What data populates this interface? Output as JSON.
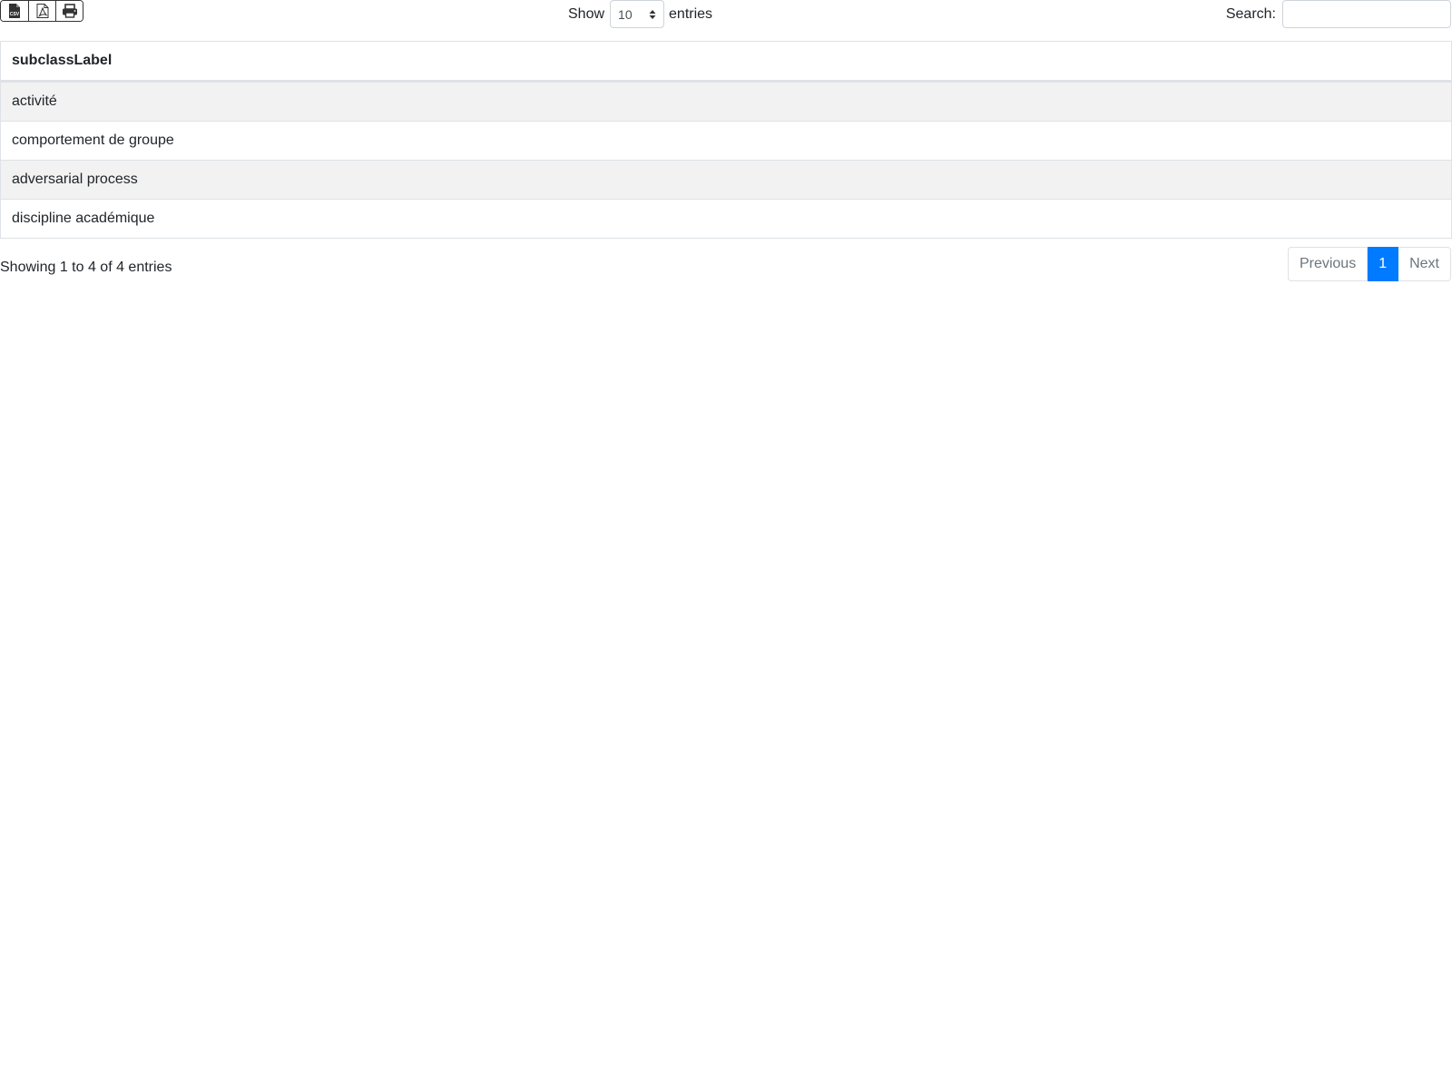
{
  "toolbar": {
    "csv_icon": "csv-file-icon",
    "pdf_icon": "pdf-file-icon",
    "print_icon": "printer-icon",
    "csv_badge": "CSV"
  },
  "length": {
    "show_label": "Show",
    "selected": "10",
    "entries_label": "entries"
  },
  "search": {
    "label": "Search:",
    "value": ""
  },
  "table": {
    "columns": [
      "subclassLabel"
    ],
    "rows": [
      [
        "activité"
      ],
      [
        "comportement de groupe"
      ],
      [
        "adversarial process"
      ],
      [
        "discipline académique"
      ]
    ]
  },
  "footer": {
    "info": "Showing 1 to 4 of 4 entries",
    "previous": "Previous",
    "current_page": "1",
    "next": "Next"
  },
  "colors": {
    "accent": "#007bff",
    "stripe": "#f2f2f2",
    "border": "#dee2e6"
  }
}
